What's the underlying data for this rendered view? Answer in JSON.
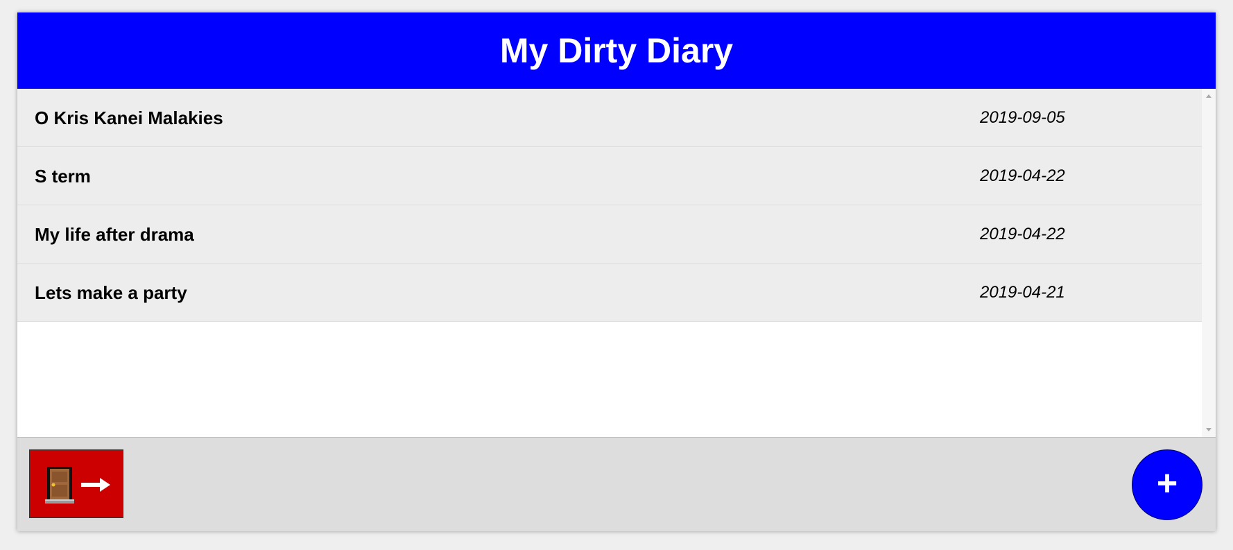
{
  "header": {
    "title": "My Dirty Diary"
  },
  "entries": [
    {
      "title": "O Kris Kanei Malakies",
      "date": "2019-09-05"
    },
    {
      "title": "S term",
      "date": "2019-04-22"
    },
    {
      "title": "My life after drama",
      "date": "2019-04-22"
    },
    {
      "title": "Lets make a party",
      "date": "2019-04-21"
    }
  ],
  "footer": {
    "logout_icon": "door-exit-icon",
    "add_label": "+"
  },
  "colors": {
    "header_bg": "#0000ff",
    "logout_bg": "#cc0000",
    "add_bg": "#0000ff",
    "entry_bg": "#ededed",
    "footer_bg": "#dddddd"
  }
}
